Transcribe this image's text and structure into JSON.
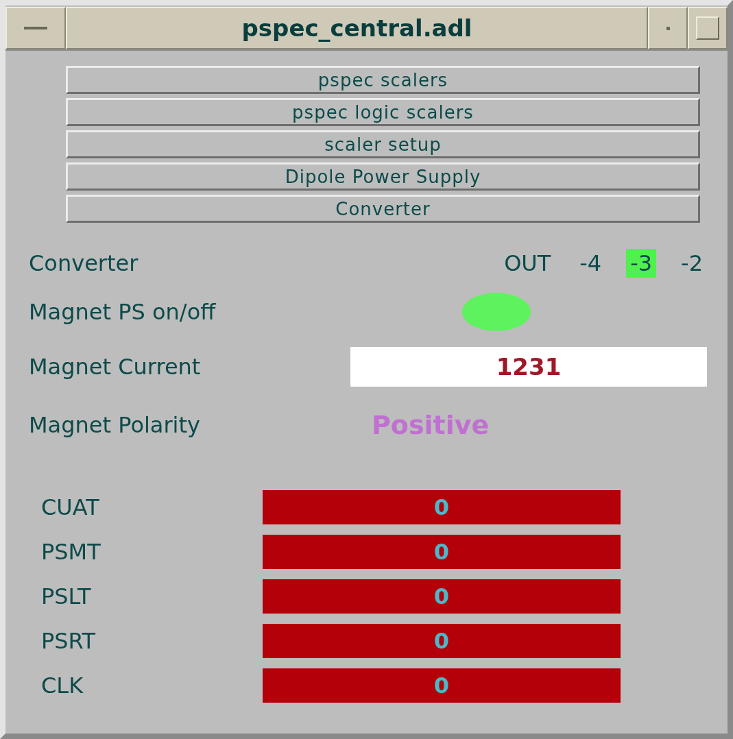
{
  "window": {
    "title": "pspec_central.adl"
  },
  "buttons": [
    "pspec scalers",
    "pspec logic scalers",
    "scaler setup",
    "Dipole Power Supply",
    "Converter"
  ],
  "converter": {
    "label": "Converter",
    "options": [
      {
        "label": "OUT",
        "selected": false
      },
      {
        "label": "-4",
        "selected": false
      },
      {
        "label": "-3",
        "selected": true
      },
      {
        "label": "-2",
        "selected": false
      }
    ]
  },
  "magnet_ps": {
    "label": "Magnet PS on/off",
    "on": true
  },
  "magnet_current": {
    "label": "Magnet Current",
    "value": "1231"
  },
  "magnet_polarity": {
    "label": "Magnet Polarity",
    "value": "Positive"
  },
  "scalers": [
    {
      "label": "CUAT",
      "value": "0"
    },
    {
      "label": "PSMT",
      "value": "0"
    },
    {
      "label": "PSLT",
      "value": "0"
    },
    {
      "label": "PSRT",
      "value": "0"
    },
    {
      "label": "CLK",
      "value": "0"
    }
  ]
}
